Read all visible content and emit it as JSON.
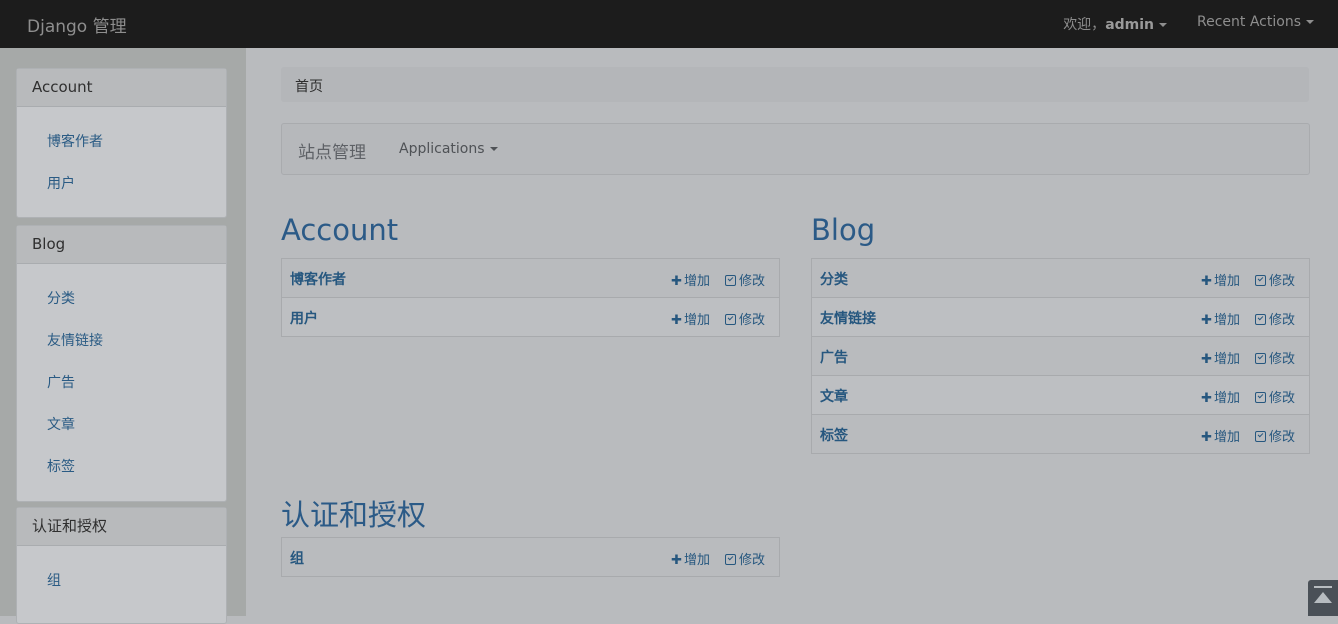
{
  "navbar": {
    "brand": "Django 管理",
    "welcome_prefix": "欢迎，",
    "username": "admin",
    "recent_actions": "Recent Actions"
  },
  "sidebar": {
    "panels": [
      {
        "title": "Account",
        "items": [
          {
            "label": "博客作者"
          },
          {
            "label": "用户"
          }
        ]
      },
      {
        "title": "Blog",
        "items": [
          {
            "label": "分类"
          },
          {
            "label": "友情链接"
          },
          {
            "label": "广告"
          },
          {
            "label": "文章"
          },
          {
            "label": "标签"
          }
        ]
      },
      {
        "title": "认证和授权",
        "items": [
          {
            "label": "组"
          }
        ]
      }
    ]
  },
  "breadcrumb": {
    "home": "首页"
  },
  "subnav": {
    "title": "站点管理",
    "apps_label": "Applications"
  },
  "actions": {
    "add": "增加",
    "change": "修改"
  },
  "modules": [
    {
      "title": "Account",
      "rows": [
        {
          "name": "博客作者"
        },
        {
          "name": "用户"
        }
      ]
    },
    {
      "title": "Blog",
      "rows": [
        {
          "name": "分类"
        },
        {
          "name": "友情链接"
        },
        {
          "name": "广告"
        },
        {
          "name": "文章"
        },
        {
          "name": "标签"
        }
      ]
    },
    {
      "title": "认证和授权",
      "rows": [
        {
          "name": "组"
        }
      ]
    }
  ]
}
